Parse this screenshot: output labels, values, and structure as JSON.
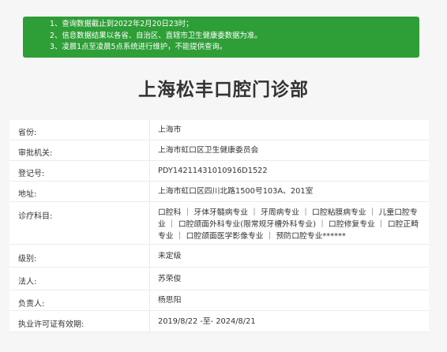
{
  "notice": {
    "lines": [
      "1、查询数据截止到2022年2月20日23时；",
      "2、信息数据结果以各省、自治区、直辖市卫生健康委数据为准。",
      "3、凌晨1点至凌晨5点系统进行维护，不能提供查询。"
    ],
    "bg_color": "#2e9e37"
  },
  "page_title": "上海松丰口腔门诊部",
  "fields": [
    {
      "label": "省份:",
      "value": "上海市"
    },
    {
      "label": "审批机关:",
      "value": "上海市虹口区卫生健康委员会"
    },
    {
      "label": "登记号:",
      "value": "PDY14211431010916D1522"
    },
    {
      "label": "地址:",
      "value": "上海市虹口区四川北路1500号103A、201室"
    },
    {
      "label": "诊疗科目:",
      "value": "口腔科 ｜ 牙体牙髓病专业 ｜ 牙周病专业 ｜ 口腔粘膜病专业 ｜ 儿童口腔专业 ｜ 口腔颌面外科专业(限常规牙槽外科专业) ｜ 口腔修复专业 ｜ 口腔正畸专业 ｜ 口腔颌面医学影像专业 ｜ 预防口腔专业******"
    },
    {
      "label": "级别:",
      "value": "未定级"
    },
    {
      "label": "法人:",
      "value": "苏荣俊"
    },
    {
      "label": "负责人:",
      "value": "杨思阳"
    },
    {
      "label": "执业许可证有效期:",
      "value": "2019/8/22 -至- 2024/8/21"
    }
  ]
}
